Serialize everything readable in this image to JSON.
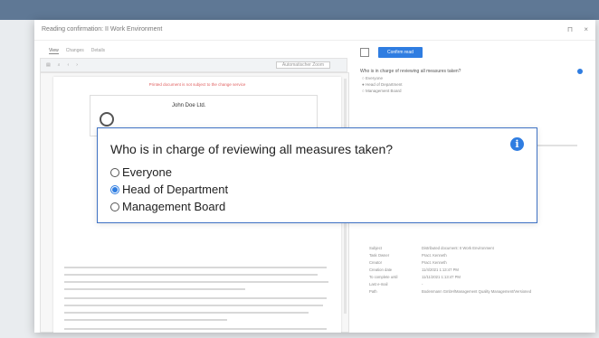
{
  "window": {
    "title": "Reading confirmation: II Work Environment"
  },
  "document_viewer": {
    "tabs": [
      "View",
      "Changes",
      "Details"
    ],
    "zoom_label": "Automatischer Zoom",
    "page_notice": "Printed document is not subject to the change service",
    "company": "John Doe Ltd."
  },
  "right_panel": {
    "confirm_label": "Confirm read",
    "question": "Who is in charge of reviewing all measures taken?",
    "options": [
      "Everyone",
      "Head of Department",
      "Management Board"
    ],
    "selected_index": 1,
    "meta": [
      {
        "k": "Subject",
        "v": "Distributed document: II Work Environment"
      },
      {
        "k": "Task Owner",
        "v": "Pract. Kenneth"
      },
      {
        "k": "Creator",
        "v": "Pract. Kenneth"
      },
      {
        "k": "Creation date",
        "v": "11/4/2021 1:13:47 PM"
      },
      {
        "k": "To complete until",
        "v": "11/11/2021 1:13:47 PM"
      },
      {
        "k": "Last e-mail",
        "v": "-"
      },
      {
        "k": "Path",
        "v": "Bodenmann GmbH/Management Quality Management/Versioned"
      }
    ]
  },
  "dialog": {
    "question": "Who is in charge of reviewing all measures taken?",
    "options": [
      "Everyone",
      "Head of Department",
      "Management Board"
    ],
    "selected_index": 1,
    "info_glyph": "i"
  },
  "colors": {
    "accent": "#2f7de1",
    "dialog_border": "#3f72c4"
  }
}
